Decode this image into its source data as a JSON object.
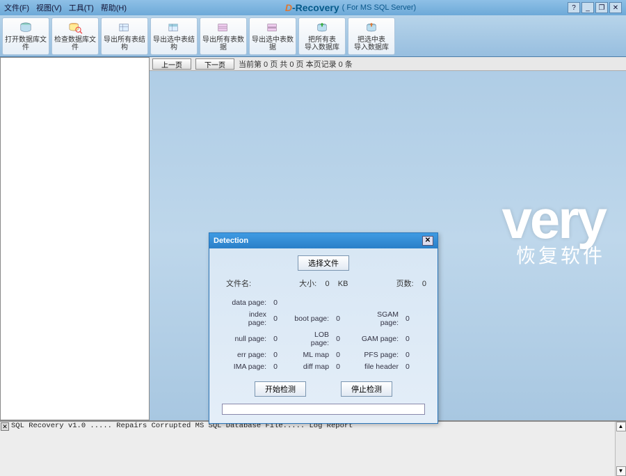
{
  "menubar": {
    "items": [
      "文件(F)",
      "视图(V)",
      "工具(T)",
      "帮助(H)"
    ],
    "logo_prefix": "D",
    "logo_text": "-Recovery",
    "for_label": "( For MS SQL Server)",
    "win_btns": [
      "?",
      "_",
      "❐",
      "✕"
    ]
  },
  "toolbar": {
    "buttons": [
      {
        "label": "打开数据库文件",
        "icon": "open-db-icon"
      },
      {
        "label": "检查数据库文件",
        "icon": "check-db-icon"
      },
      {
        "label": "导出所有表结构",
        "icon": "export-all-struct-icon"
      },
      {
        "label": "导出选中表结构",
        "icon": "export-sel-struct-icon"
      },
      {
        "label": "导出所有表数据",
        "icon": "export-all-data-icon"
      },
      {
        "label": "导出选中表数据",
        "icon": "export-sel-data-icon"
      },
      {
        "label": "把所有表\n导入数据库",
        "icon": "import-all-icon"
      },
      {
        "label": "把选中表\n导入数据库",
        "icon": "import-sel-icon"
      }
    ]
  },
  "page_nav": {
    "prev": "上一页",
    "next": "下一页",
    "status": "当前第   0  页 共   0  页  本页记录   0      条"
  },
  "bg": {
    "big": "very",
    "sub": "恢复软件"
  },
  "dialog": {
    "title": "Detection",
    "select_file": "选择文件",
    "file_label": "文件名:",
    "size_label": "大小:",
    "size_value": "0",
    "size_unit": "KB",
    "pages_label": "页数:",
    "pages_value": "0",
    "stats": {
      "col1": [
        {
          "label": "data page:",
          "value": "0"
        },
        {
          "label": "index page:",
          "value": "0"
        },
        {
          "label": "null page:",
          "value": "0"
        },
        {
          "label": "err page:",
          "value": "0"
        },
        {
          "label": "IMA page:",
          "value": "0"
        }
      ],
      "col2": [
        {
          "label": "boot page:",
          "value": "0"
        },
        {
          "label": "LOB page:",
          "value": "0"
        },
        {
          "label": "ML map",
          "value": "0"
        },
        {
          "label": "diff map",
          "value": "0"
        }
      ],
      "col3": [
        {
          "label": "SGAM page:",
          "value": "0"
        },
        {
          "label": "GAM page:",
          "value": "0"
        },
        {
          "label": "PFS page:",
          "value": "0"
        },
        {
          "label": "file header",
          "value": "0"
        }
      ]
    },
    "start": "开始检测",
    "stop": "停止检测"
  },
  "log": {
    "text": "SQL Recovery v1.0 ..... Repairs Corrupted MS SQL Database File..... Log Report"
  }
}
